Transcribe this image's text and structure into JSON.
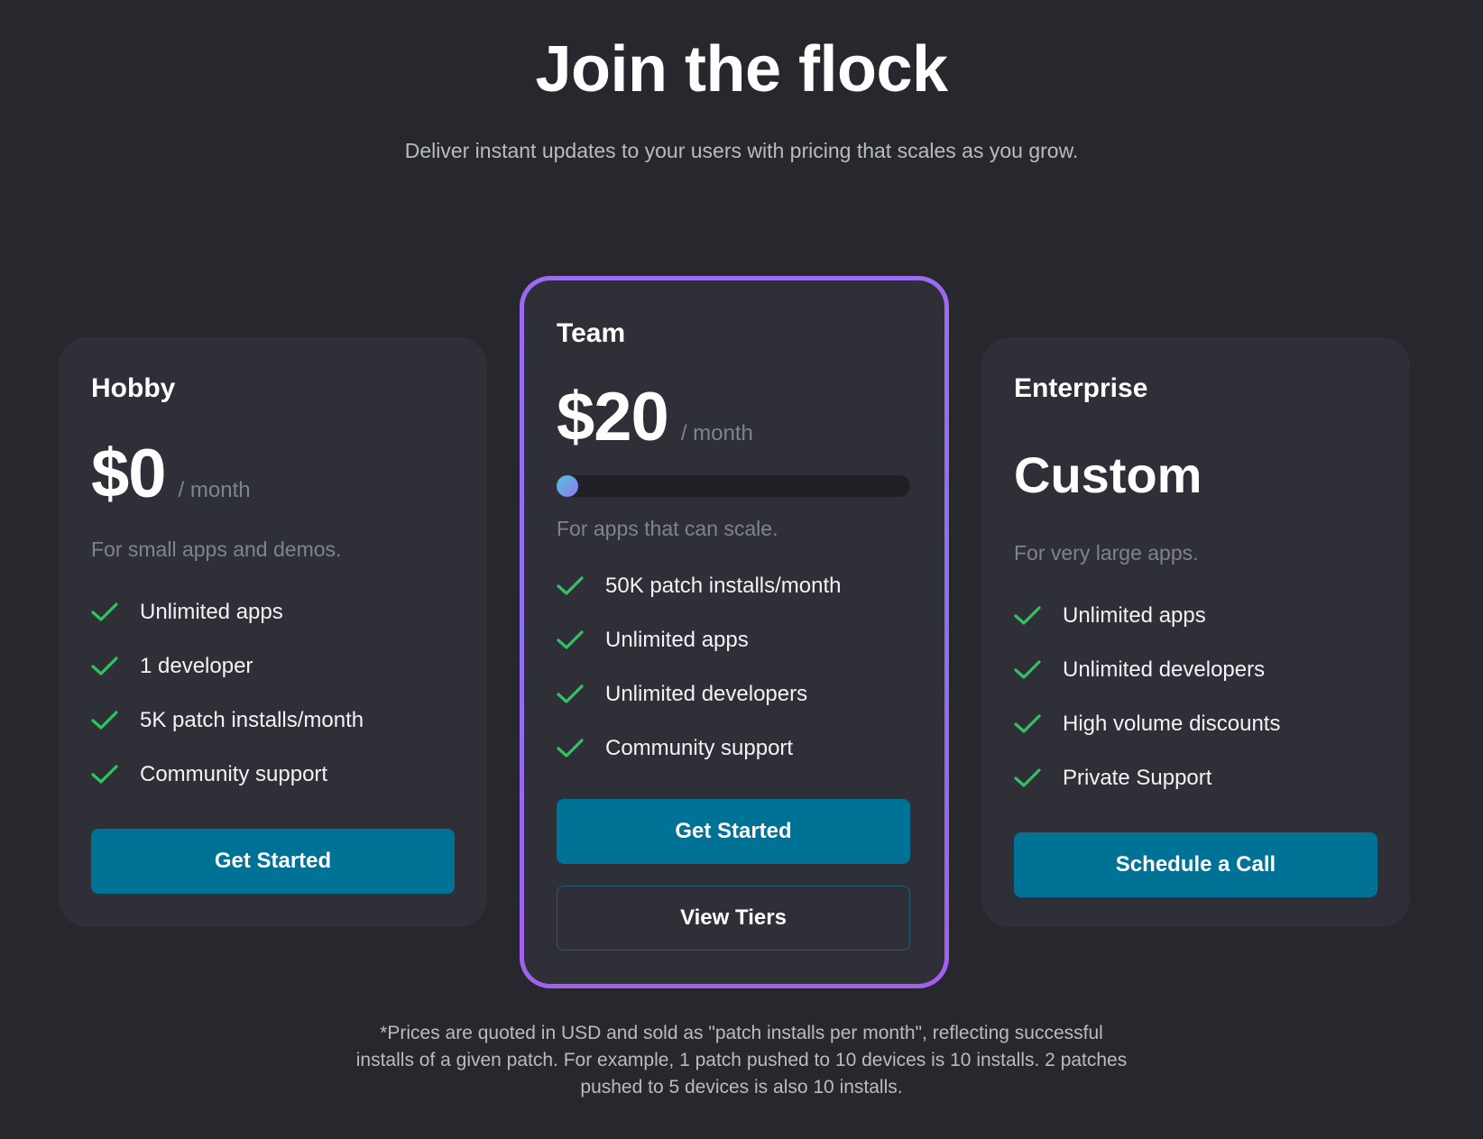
{
  "header": {
    "title": "Join the flock",
    "subtitle": "Deliver instant updates to your users with pricing that scales as you grow."
  },
  "colors": {
    "background": "#27282d",
    "card": "#2f3037",
    "accent_button": "#007295",
    "check_green": "#2fc45f",
    "featured_border": "#9b6bf0"
  },
  "plans": [
    {
      "name": "Hobby",
      "price": "$0",
      "period": "/ month",
      "description": "For small apps and demos.",
      "features": [
        "Unlimited apps",
        "1 developer",
        "5K patch installs/month",
        "Community support"
      ],
      "cta_label": "Get Started"
    },
    {
      "name": "Team",
      "price": "$20",
      "period": "/ month",
      "tier_slider_level": 0,
      "description": "For apps that can scale.",
      "features": [
        "50K patch installs/month",
        "Unlimited apps",
        "Unlimited developers",
        "Community support"
      ],
      "cta_label": "Get Started",
      "secondary_label": "View Tiers"
    },
    {
      "name": "Enterprise",
      "price": "Custom",
      "description": "For very large apps.",
      "features": [
        "Unlimited apps",
        "Unlimited developers",
        "High volume discounts",
        "Private Support"
      ],
      "cta_label": "Schedule a Call"
    }
  ],
  "footnote": {
    "lines": [
      "*Prices are quoted in USD and sold as \"patch installs per month\", reflecting successful",
      "installs of a given patch. For example, 1 patch pushed to 10 devices is 10 installs. 2 patches",
      "pushed to 5 devices is also 10 installs."
    ]
  },
  "icons": {
    "feature_check": "check-icon"
  }
}
